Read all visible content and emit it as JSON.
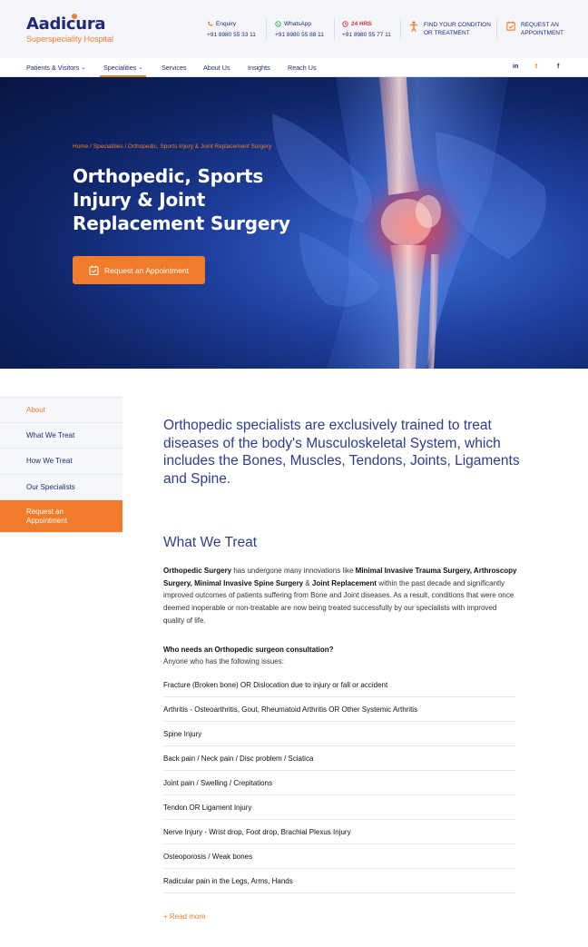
{
  "logo": {
    "name": "Aadicura",
    "subtitle": "Superspeciality Hospital"
  },
  "contacts": [
    {
      "label": "Enquiry",
      "number": "+91 8980 55 33 11",
      "icon": "phone-icon"
    },
    {
      "label": "WhatsApp",
      "number": "+91 8980 55 88 11",
      "icon": "whatsapp-icon"
    },
    {
      "label": "24 HRS",
      "number": "+91 8980 55 77 11",
      "icon": "clock-icon"
    }
  ],
  "header_ctas": [
    {
      "line1": "FIND YOUR CONDITION",
      "line2": "OR TREATMENT",
      "icon": "person-icon"
    },
    {
      "line1": "REQUEST AN",
      "line2": "APPOINTMENT",
      "icon": "calendar-icon"
    }
  ],
  "nav": {
    "items": [
      "Patients & Visitors",
      "Specialities",
      "Services",
      "About Us",
      "Insights",
      "Reach Us"
    ],
    "social": [
      "in",
      "t",
      "f"
    ]
  },
  "hero": {
    "breadcrumb": "Home / Specialities / Orthopedic, Sports Injury & Joint Replacement Surgery",
    "title": "Orthopedic, Sports Injury & Joint Replacement Surgery",
    "button": "Request an Appointment"
  },
  "sidebar": [
    "About",
    "What We Treat",
    "How We Treat",
    "Our Specialists",
    "Request an Appointment"
  ],
  "lead": "Orthopedic specialists are exclusively trained to treat diseases of the body's Musculoskeletal System, which includes the Bones, Muscles, Tendons, Joints, Ligaments and Spine.",
  "section": {
    "heading": "What We Treat",
    "para": {
      "b1": "Orthopedic Surgery",
      "t1": " has undergone many innovations like ",
      "b2": "Minimal Invasive Trauma Surgery, Arthroscopy Surgery, Minimal Invasive Spine Surgery",
      "t2": " & ",
      "b3": "Joint Replacement",
      "t3": " within the past decade and significantly improved outcomes of patients suffering from Bone and Joint diseases. As a result, conditions that were once deemed inoperable or non-treatable are now being treated successfully by our specialists with improved quality of life."
    },
    "question": "Who needs an Orthopedic surgeon consultation?",
    "question_sub": "Anyone who has the following issues:",
    "issues": [
      "Fracture (Broken bone) OR Dislocation due to injury or fall or accident",
      "Arthritis - Osteoarthritis, Gout, Rheumatoid Arthritis OR Other Systemic Arthritis",
      "Spine Injury",
      "Back pain / Neck pain / Disc problem / Sciatica",
      "Joint pain / Swelling / Crepitations",
      "Tendon OR Ligament Injury",
      "Nerve Injury - Wrist drop, Foot drop, Brachial Plexus Injury",
      "Osteoporosis / Weak bones",
      "Radicular pain in the Legs, Arms, Hands"
    ],
    "read_more": "+ Read more"
  },
  "colors": {
    "brand_navy": "#1e2a78",
    "accent_orange": "#f07b2a",
    "alert_red": "#d6332b"
  }
}
